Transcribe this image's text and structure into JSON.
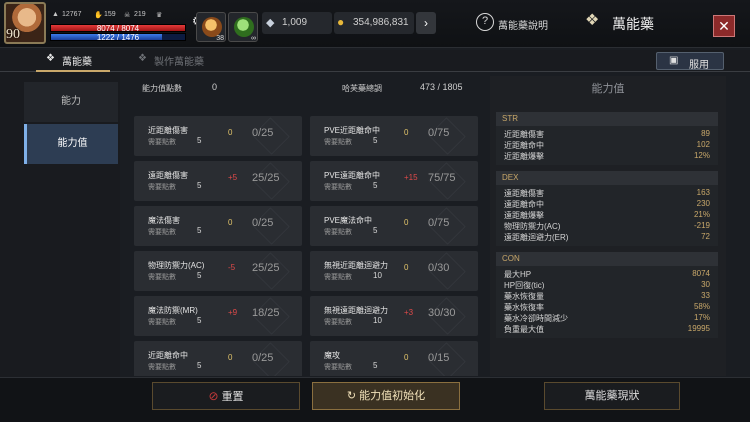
{
  "player": {
    "level": "90",
    "stat_a": "12767",
    "stat_b": "159",
    "stat_c": "219",
    "hp": "8074 / 8074",
    "hp_fraction": 1.0,
    "mp": "1222 / 1476",
    "mp_fraction": 0.828
  },
  "slots": [
    {
      "count": "38",
      "icon": "potion-icon"
    },
    {
      "count": "∞",
      "icon": "leaf-icon"
    }
  ],
  "currency": {
    "gem": "1,009",
    "gold": "354,986,831"
  },
  "header": {
    "help_label": "萬能藥說明",
    "title": "萬能藥",
    "close": "✕"
  },
  "tabs": {
    "active": "萬能藥",
    "inactive": "製作萬能藥",
    "use_button": "服用"
  },
  "nav": {
    "item1": "能力",
    "item2": "能力值"
  },
  "summary": {
    "points_label": "能力值點數",
    "points_value": "0",
    "exp_label": "哈芙藥總調",
    "exp_value": "473 / 1805"
  },
  "need_label": "需要點數",
  "cells": [
    {
      "name": "近距離傷害",
      "need": "5",
      "add": "0",
      "add_type": "zero",
      "prog": "0/25"
    },
    {
      "name": "PVE近距離命中",
      "need": "5",
      "add": "0",
      "add_type": "zero",
      "prog": "0/75"
    },
    {
      "name": "遠距離傷害",
      "need": "5",
      "add": "+5",
      "add_type": "pos",
      "prog": "25/25"
    },
    {
      "name": "PVE遠距離命中",
      "need": "5",
      "add": "+15",
      "add_type": "pos",
      "prog": "75/75"
    },
    {
      "name": "魔法傷害",
      "need": "5",
      "add": "0",
      "add_type": "zero",
      "prog": "0/25"
    },
    {
      "name": "PVE魔法命中",
      "need": "5",
      "add": "0",
      "add_type": "zero",
      "prog": "0/75"
    },
    {
      "name": "物理防禦力(AC)",
      "need": "5",
      "add": "-5",
      "add_type": "neg",
      "prog": "25/25"
    },
    {
      "name": "無視近距離迴避力",
      "need": "10",
      "add": "0",
      "add_type": "zero",
      "prog": "0/30"
    },
    {
      "name": "魔法防禦(MR)",
      "need": "5",
      "add": "+9",
      "add_type": "pos",
      "prog": "18/25"
    },
    {
      "name": "無視遠距離迴避力",
      "need": "10",
      "add": "+3",
      "add_type": "pos",
      "prog": "30/30"
    },
    {
      "name": "近距離命中",
      "need": "5",
      "add": "0",
      "add_type": "zero",
      "prog": "0/25"
    },
    {
      "name": "魔攻",
      "need": "5",
      "add": "0",
      "add_type": "zero",
      "prog": "0/15"
    }
  ],
  "stats": {
    "title": "能力值",
    "groups": [
      {
        "name": "STR",
        "rows": [
          {
            "k": "近距離傷害",
            "v": "89"
          },
          {
            "k": "近距離命中",
            "v": "102"
          },
          {
            "k": "近距離爆擊",
            "v": "12%"
          }
        ]
      },
      {
        "name": "DEX",
        "rows": [
          {
            "k": "遠距離傷害",
            "v": "163"
          },
          {
            "k": "遠距離命中",
            "v": "230"
          },
          {
            "k": "遠距離爆擊",
            "v": "21%"
          },
          {
            "k": "物理防禦力(AC)",
            "v": "-219"
          },
          {
            "k": "遠距離迴避力(ER)",
            "v": "72"
          }
        ]
      },
      {
        "name": "CON",
        "rows": [
          {
            "k": "最大HP",
            "v": "8074"
          },
          {
            "k": "HP回復(tic)",
            "v": "30"
          },
          {
            "k": "藥水恢復量",
            "v": "33"
          },
          {
            "k": "藥水恢復率",
            "v": "58%"
          },
          {
            "k": "藥水冷卻時間減少",
            "v": "17%"
          },
          {
            "k": "負重最大值",
            "v": "19995"
          }
        ]
      }
    ]
  },
  "bottom": {
    "left_button": "重置",
    "mid_button": "能力值初始化",
    "right_button": "萬能藥現狀"
  },
  "colors": {
    "accent_gold": "#c9a86a",
    "hp_red": "#e33a3a",
    "mp_blue": "#3b7bea",
    "close_red": "#8c2a2a"
  }
}
